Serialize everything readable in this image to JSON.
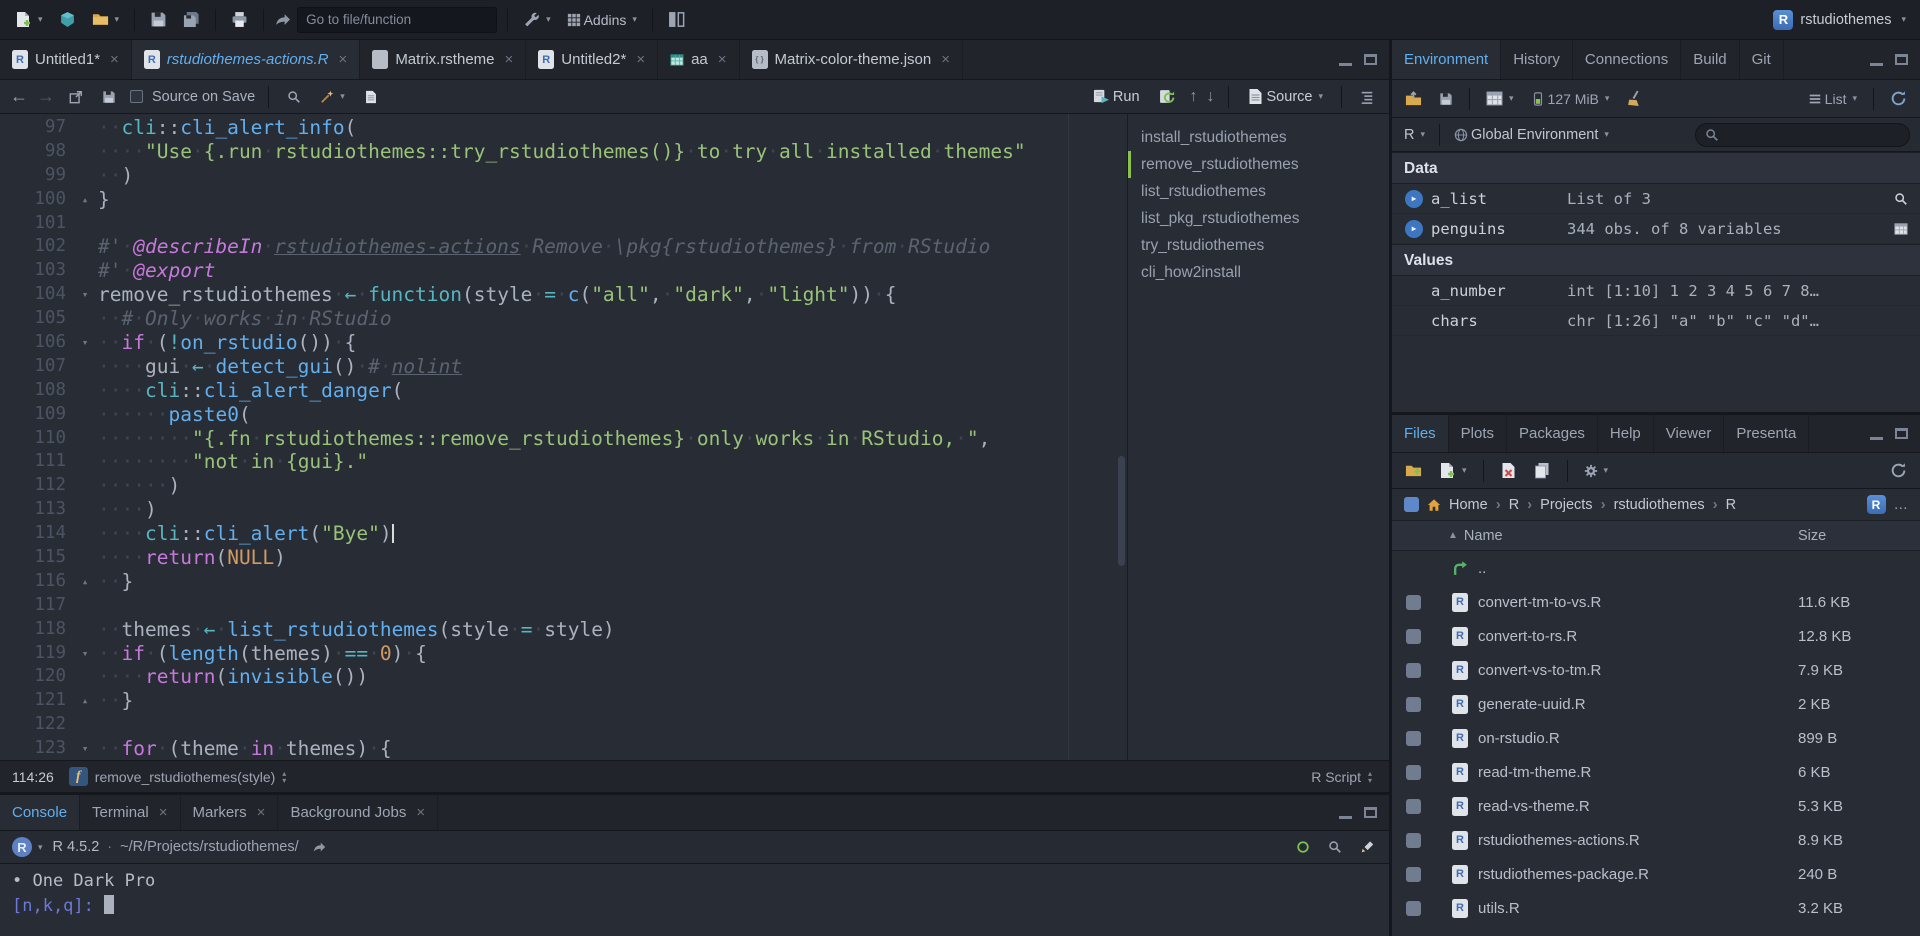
{
  "palette": {
    "editor_bg": "#282c34",
    "panel_bg": "#21252b",
    "toolbar_bg": "#262b33",
    "border": "#14171c",
    "fg": "#abb2bf",
    "muted": "#9da5b4",
    "accent_blue": "#61afef",
    "green": "#98c379",
    "purple": "#c678dd",
    "cyan": "#56b6c2",
    "orange": "#d19a66",
    "red": "#e06c75",
    "comment": "#5c6370",
    "prompt_blue": "#6c79d8",
    "outline_marker_green": "#8bc34a"
  },
  "top_toolbar": {
    "goto_placeholder": "Go to file/function",
    "addins_label": "Addins",
    "project_name": "rstudiothemes"
  },
  "source_pane": {
    "tabs": [
      {
        "label": "Untitled1*",
        "icon": "r-file",
        "active": false
      },
      {
        "label": "rstudiothemes-actions.R",
        "icon": "r-file",
        "active": true
      },
      {
        "label": "Matrix.rstheme",
        "icon": "plain-file",
        "active": false
      },
      {
        "label": "Untitled2*",
        "icon": "r-file",
        "active": false
      },
      {
        "label": "aa",
        "icon": "table-file",
        "active": false
      },
      {
        "label": "Matrix-color-theme.json",
        "icon": "json-file",
        "active": false
      }
    ],
    "toolbar": {
      "source_on_save_label": "Source on Save",
      "run_label": "Run",
      "source_label": "Source"
    },
    "status_bar": {
      "cursor_position": "114:26",
      "scope_label": "remove_rstudiothemes(style)",
      "file_type": "R Script"
    },
    "outline": {
      "items": [
        "install_rstudiothemes",
        "remove_rstudiothemes",
        "list_rstudiothemes",
        "list_pkg_rstudiothemes",
        "try_rstudiothemes",
        "cli_how2install"
      ],
      "active_index": 1
    },
    "code_lines": [
      {
        "n": 97,
        "segs": [
          [
            "t",
            "  "
          ],
          [
            "pk",
            "cli"
          ],
          [
            "t",
            "::"
          ],
          [
            "c",
            "cli_alert_info"
          ],
          [
            "t",
            "("
          ]
        ]
      },
      {
        "n": 98,
        "segs": [
          [
            "t",
            "    "
          ],
          [
            "s",
            "\"Use {.run rstudiothemes::try_rstudiothemes()} to try all installed themes\""
          ]
        ]
      },
      {
        "n": 99,
        "segs": [
          [
            "t",
            "  )"
          ]
        ]
      },
      {
        "n": 100,
        "fold": "close",
        "segs": [
          [
            "t",
            "}"
          ]
        ]
      },
      {
        "n": 101,
        "segs": []
      },
      {
        "n": 102,
        "segs": [
          [
            "cm",
            "#' "
          ],
          [
            "tag",
            "@describeIn"
          ],
          [
            "cm",
            " "
          ],
          [
            "lnk",
            "rstudiothemes-actions"
          ],
          [
            "cm",
            " Remove \\pkg{rstudiothemes} from RStudio"
          ]
        ]
      },
      {
        "n": 103,
        "segs": [
          [
            "cm",
            "#' "
          ],
          [
            "tag",
            "@export"
          ]
        ]
      },
      {
        "n": 104,
        "fold": "open",
        "segs": [
          [
            "t",
            "remove_rstudiothemes "
          ],
          [
            "op",
            "←"
          ],
          [
            "t",
            " "
          ],
          [
            "fk",
            "function"
          ],
          [
            "t",
            "(style "
          ],
          [
            "op",
            "="
          ],
          [
            "t",
            " "
          ],
          [
            "c",
            "c"
          ],
          [
            "t",
            "("
          ],
          [
            "s",
            "\"all\""
          ],
          [
            "t",
            ", "
          ],
          [
            "s",
            "\"dark\""
          ],
          [
            "t",
            ", "
          ],
          [
            "s",
            "\"light\""
          ],
          [
            "t",
            ")) {"
          ]
        ]
      },
      {
        "n": 105,
        "segs": [
          [
            "t",
            "  "
          ],
          [
            "cm",
            "# Only works in RStudio"
          ]
        ]
      },
      {
        "n": 106,
        "fold": "open",
        "segs": [
          [
            "t",
            "  "
          ],
          [
            "k",
            "if"
          ],
          [
            "t",
            " ("
          ],
          [
            "op",
            "!"
          ],
          [
            "c",
            "on_rstudio"
          ],
          [
            "t",
            "()) {"
          ]
        ]
      },
      {
        "n": 107,
        "segs": [
          [
            "t",
            "    gui "
          ],
          [
            "op",
            "←"
          ],
          [
            "t",
            " "
          ],
          [
            "c",
            "detect_gui"
          ],
          [
            "t",
            "() "
          ],
          [
            "cm",
            "# "
          ],
          [
            "cmu",
            "nolint"
          ]
        ]
      },
      {
        "n": 108,
        "segs": [
          [
            "t",
            "    "
          ],
          [
            "pk",
            "cli"
          ],
          [
            "t",
            "::"
          ],
          [
            "c",
            "cli_alert_danger"
          ],
          [
            "t",
            "("
          ]
        ]
      },
      {
        "n": 109,
        "segs": [
          [
            "t",
            "      "
          ],
          [
            "c",
            "paste0"
          ],
          [
            "t",
            "("
          ]
        ]
      },
      {
        "n": 110,
        "segs": [
          [
            "t",
            "        "
          ],
          [
            "s",
            "\"{.fn rstudiothemes::remove_rstudiothemes} only works in RStudio, \""
          ],
          [
            "t",
            ","
          ]
        ]
      },
      {
        "n": 111,
        "segs": [
          [
            "t",
            "        "
          ],
          [
            "s",
            "\"not in {gui}.\""
          ]
        ]
      },
      {
        "n": 112,
        "segs": [
          [
            "t",
            "      )"
          ]
        ]
      },
      {
        "n": 113,
        "segs": [
          [
            "t",
            "    )"
          ]
        ]
      },
      {
        "n": 114,
        "cursor": true,
        "segs": [
          [
            "t",
            "    "
          ],
          [
            "pk",
            "cli"
          ],
          [
            "t",
            "::"
          ],
          [
            "c",
            "cli_alert"
          ],
          [
            "t",
            "("
          ],
          [
            "s",
            "\"Bye\""
          ],
          [
            "t",
            ")"
          ]
        ]
      },
      {
        "n": 115,
        "segs": [
          [
            "t",
            "    "
          ],
          [
            "k",
            "return"
          ],
          [
            "t",
            "("
          ],
          [
            "n2",
            "NULL"
          ],
          [
            "t",
            ")"
          ]
        ]
      },
      {
        "n": 116,
        "fold": "close",
        "segs": [
          [
            "t",
            "  }"
          ]
        ]
      },
      {
        "n": 117,
        "segs": []
      },
      {
        "n": 118,
        "segs": [
          [
            "t",
            "  themes "
          ],
          [
            "op",
            "←"
          ],
          [
            "t",
            " "
          ],
          [
            "c",
            "list_rstudiothemes"
          ],
          [
            "t",
            "(style "
          ],
          [
            "op",
            "="
          ],
          [
            "t",
            " style)"
          ]
        ]
      },
      {
        "n": 119,
        "fold": "open",
        "segs": [
          [
            "t",
            "  "
          ],
          [
            "k",
            "if"
          ],
          [
            "t",
            " ("
          ],
          [
            "c",
            "length"
          ],
          [
            "t",
            "(themes) "
          ],
          [
            "op",
            "=="
          ],
          [
            "t",
            " "
          ],
          [
            "n2",
            "0"
          ],
          [
            "t",
            ") {"
          ]
        ]
      },
      {
        "n": 120,
        "segs": [
          [
            "t",
            "    "
          ],
          [
            "k",
            "return"
          ],
          [
            "t",
            "("
          ],
          [
            "c",
            "invisible"
          ],
          [
            "t",
            "())"
          ]
        ]
      },
      {
        "n": 121,
        "fold": "close",
        "segs": [
          [
            "t",
            "  }"
          ]
        ]
      },
      {
        "n": 122,
        "segs": []
      },
      {
        "n": 123,
        "fold": "open",
        "segs": [
          [
            "t",
            "  "
          ],
          [
            "k",
            "for"
          ],
          [
            "t",
            " (theme "
          ],
          [
            "k",
            "in"
          ],
          [
            "t",
            " themes) {"
          ]
        ]
      }
    ]
  },
  "console_pane": {
    "tabs": [
      {
        "label": "Console",
        "active": true,
        "closable": false
      },
      {
        "label": "Terminal",
        "active": false,
        "closable": true
      },
      {
        "label": "Markers",
        "active": false,
        "closable": true
      },
      {
        "label": "Background Jobs",
        "active": false,
        "closable": true
      }
    ],
    "toolbar": {
      "r_version": "R 4.5.2",
      "separator": "·",
      "working_dir": "~/R/Projects/rstudiothemes/"
    },
    "output_line": "• One Dark Pro",
    "prompt": "[n,k,q]: "
  },
  "environment_pane": {
    "tabs": [
      "Environment",
      "History",
      "Connections",
      "Build",
      "Git"
    ],
    "active_tab": 0,
    "toolbar": {
      "memory_label": "127 MiB",
      "list_label": "List"
    },
    "scope_row": {
      "language": "R",
      "scope": "Global Environment"
    },
    "sections": [
      {
        "title": "Data",
        "items": [
          {
            "name": "a_list",
            "value": "List of 3",
            "expandable": true,
            "action": "magnifier"
          },
          {
            "name": "penguins",
            "value": "344 obs. of 8 variables",
            "expandable": true,
            "action": "table"
          }
        ]
      },
      {
        "title": "Values",
        "items": [
          {
            "name": "a_number",
            "value": "int [1:10] 1 2 3 4 5 6 7 8…",
            "expandable": false
          },
          {
            "name": "chars",
            "value": "chr [1:26] \"a\" \"b\" \"c\" \"d\"…",
            "expandable": false
          }
        ]
      }
    ]
  },
  "files_pane": {
    "tabs": [
      "Files",
      "Plots",
      "Packages",
      "Help",
      "Viewer",
      "Presenta"
    ],
    "active_tab": 0,
    "breadcrumb": [
      "Home",
      "R",
      "Projects",
      "rstudiothemes",
      "R"
    ],
    "more_label": "…",
    "columns": {
      "name": "Name",
      "size": "Size"
    },
    "files": [
      {
        "name": "..",
        "type": "up",
        "size": ""
      },
      {
        "name": "convert-tm-to-vs.R",
        "type": "r",
        "size": "11.6 KB"
      },
      {
        "name": "convert-to-rs.R",
        "type": "r",
        "size": "12.8 KB"
      },
      {
        "name": "convert-vs-to-tm.R",
        "type": "r",
        "size": "7.9 KB"
      },
      {
        "name": "generate-uuid.R",
        "type": "r",
        "size": "2 KB"
      },
      {
        "name": "on-rstudio.R",
        "type": "r",
        "size": "899 B"
      },
      {
        "name": "read-tm-theme.R",
        "type": "r",
        "size": "6 KB"
      },
      {
        "name": "read-vs-theme.R",
        "type": "r",
        "size": "5.3 KB"
      },
      {
        "name": "rstudiothemes-actions.R",
        "type": "r",
        "size": "8.9 KB"
      },
      {
        "name": "rstudiothemes-package.R",
        "type": "r",
        "size": "240 B"
      },
      {
        "name": "utils.R",
        "type": "r",
        "size": "3.2 KB"
      }
    ]
  }
}
